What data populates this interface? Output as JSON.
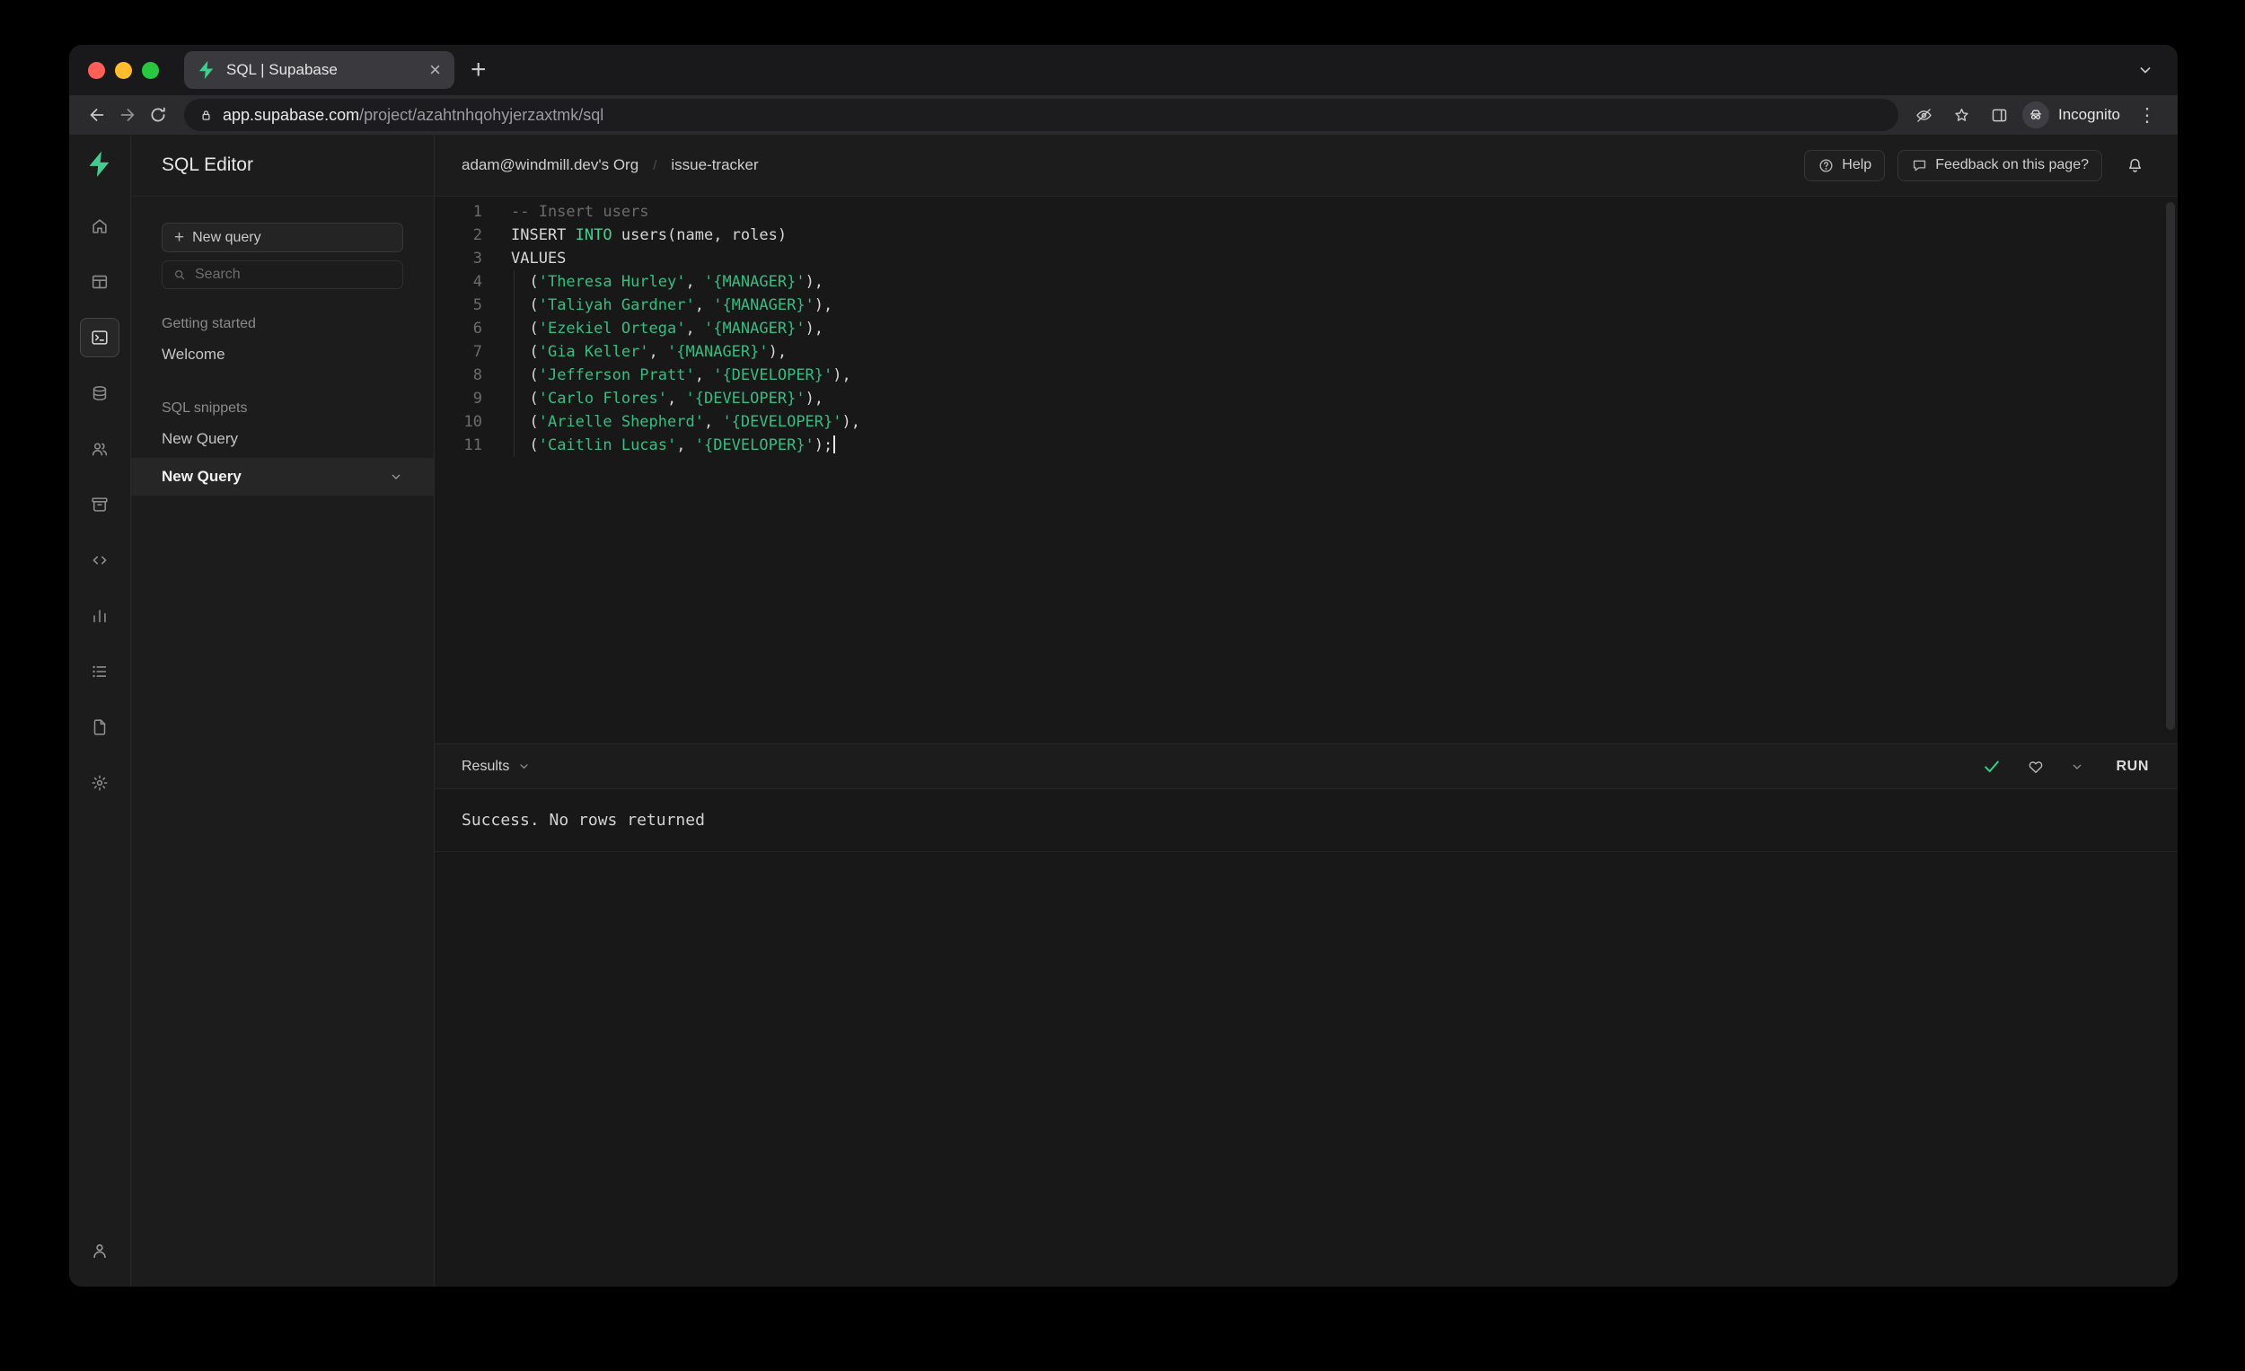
{
  "colors": {
    "accent": "#3ecf8e",
    "keyword": "#3fd392",
    "string": "#34bd83",
    "comment": "#6b6b6b"
  },
  "icons": {
    "new_tab": "+",
    "close_tab": "×",
    "menu_overflow": "⋮",
    "breadcrumb_separator": "/"
  },
  "browser": {
    "tab_title": "SQL | Supabase",
    "url_domain": "app.supabase.com",
    "url_path": "/project/azahtnhqohyjerzaxtmk/sql",
    "incognito_label": "Incognito"
  },
  "rail": {
    "items": [
      {
        "id": "home",
        "icon": "home"
      },
      {
        "id": "table-editor",
        "icon": "table"
      },
      {
        "id": "sql-editor",
        "icon": "terminal",
        "active": true
      },
      {
        "id": "database",
        "icon": "database"
      },
      {
        "id": "auth",
        "icon": "users"
      },
      {
        "id": "storage",
        "icon": "archive"
      },
      {
        "id": "edge-functions",
        "icon": "code"
      },
      {
        "id": "reports",
        "icon": "chart"
      },
      {
        "id": "logs",
        "icon": "list"
      },
      {
        "id": "api-docs",
        "icon": "file"
      },
      {
        "id": "settings",
        "icon": "gear"
      }
    ]
  },
  "sidebar": {
    "title": "SQL Editor",
    "new_query_label": "New query",
    "search_placeholder": "Search",
    "sections": [
      {
        "label": "Getting started",
        "items": [
          {
            "label": "Welcome"
          }
        ]
      },
      {
        "label": "SQL snippets",
        "items": [
          {
            "label": "New Query"
          },
          {
            "label": "New Query",
            "active": true
          }
        ]
      }
    ]
  },
  "header": {
    "org": "adam@windmill.dev's Org",
    "project": "issue-tracker",
    "help_label": "Help",
    "feedback_label": "Feedback on this page?"
  },
  "editor": {
    "lines": [
      {
        "num": "1",
        "segs": [
          {
            "t": "comment",
            "x": "-- Insert users"
          }
        ]
      },
      {
        "num": "2",
        "segs": [
          {
            "t": "plain",
            "x": "INSERT "
          },
          {
            "t": "keyword",
            "x": "INTO"
          },
          {
            "t": "plain",
            "x": " users(name, roles)"
          }
        ]
      },
      {
        "num": "3",
        "segs": [
          {
            "t": "plain",
            "x": "VALUES"
          }
        ]
      },
      {
        "num": "4",
        "segs": [
          {
            "t": "plain",
            "x": "  ("
          },
          {
            "t": "string",
            "x": "'Theresa Hurley'"
          },
          {
            "t": "plain",
            "x": ", "
          },
          {
            "t": "string",
            "x": "'{MANAGER}'"
          },
          {
            "t": "plain",
            "x": "),"
          }
        ]
      },
      {
        "num": "5",
        "segs": [
          {
            "t": "plain",
            "x": "  ("
          },
          {
            "t": "string",
            "x": "'Taliyah Gardner'"
          },
          {
            "t": "plain",
            "x": ", "
          },
          {
            "t": "string",
            "x": "'{MANAGER}'"
          },
          {
            "t": "plain",
            "x": "),"
          }
        ]
      },
      {
        "num": "6",
        "segs": [
          {
            "t": "plain",
            "x": "  ("
          },
          {
            "t": "string",
            "x": "'Ezekiel Ortega'"
          },
          {
            "t": "plain",
            "x": ", "
          },
          {
            "t": "string",
            "x": "'{MANAGER}'"
          },
          {
            "t": "plain",
            "x": "),"
          }
        ]
      },
      {
        "num": "7",
        "segs": [
          {
            "t": "plain",
            "x": "  ("
          },
          {
            "t": "string",
            "x": "'Gia Keller'"
          },
          {
            "t": "plain",
            "x": ", "
          },
          {
            "t": "string",
            "x": "'{MANAGER}'"
          },
          {
            "t": "plain",
            "x": "),"
          }
        ]
      },
      {
        "num": "8",
        "segs": [
          {
            "t": "plain",
            "x": "  ("
          },
          {
            "t": "string",
            "x": "'Jefferson Pratt'"
          },
          {
            "t": "plain",
            "x": ", "
          },
          {
            "t": "string",
            "x": "'{DEVELOPER}'"
          },
          {
            "t": "plain",
            "x": "),"
          }
        ]
      },
      {
        "num": "9",
        "segs": [
          {
            "t": "plain",
            "x": "  ("
          },
          {
            "t": "string",
            "x": "'Carlo Flores'"
          },
          {
            "t": "plain",
            "x": ", "
          },
          {
            "t": "string",
            "x": "'{DEVELOPER}'"
          },
          {
            "t": "plain",
            "x": "),"
          }
        ]
      },
      {
        "num": "10",
        "segs": [
          {
            "t": "plain",
            "x": "  ("
          },
          {
            "t": "string",
            "x": "'Arielle Shepherd'"
          },
          {
            "t": "plain",
            "x": ", "
          },
          {
            "t": "string",
            "x": "'{DEVELOPER}'"
          },
          {
            "t": "plain",
            "x": "),"
          }
        ]
      },
      {
        "num": "11",
        "cursor": true,
        "segs": [
          {
            "t": "plain",
            "x": "  ("
          },
          {
            "t": "string",
            "x": "'Caitlin Lucas'"
          },
          {
            "t": "plain",
            "x": ", "
          },
          {
            "t": "string",
            "x": "'{DEVELOPER}'"
          },
          {
            "t": "plain",
            "x": ");"
          }
        ]
      }
    ]
  },
  "results": {
    "label": "Results",
    "run_label": "RUN",
    "message": "Success. No rows returned"
  }
}
